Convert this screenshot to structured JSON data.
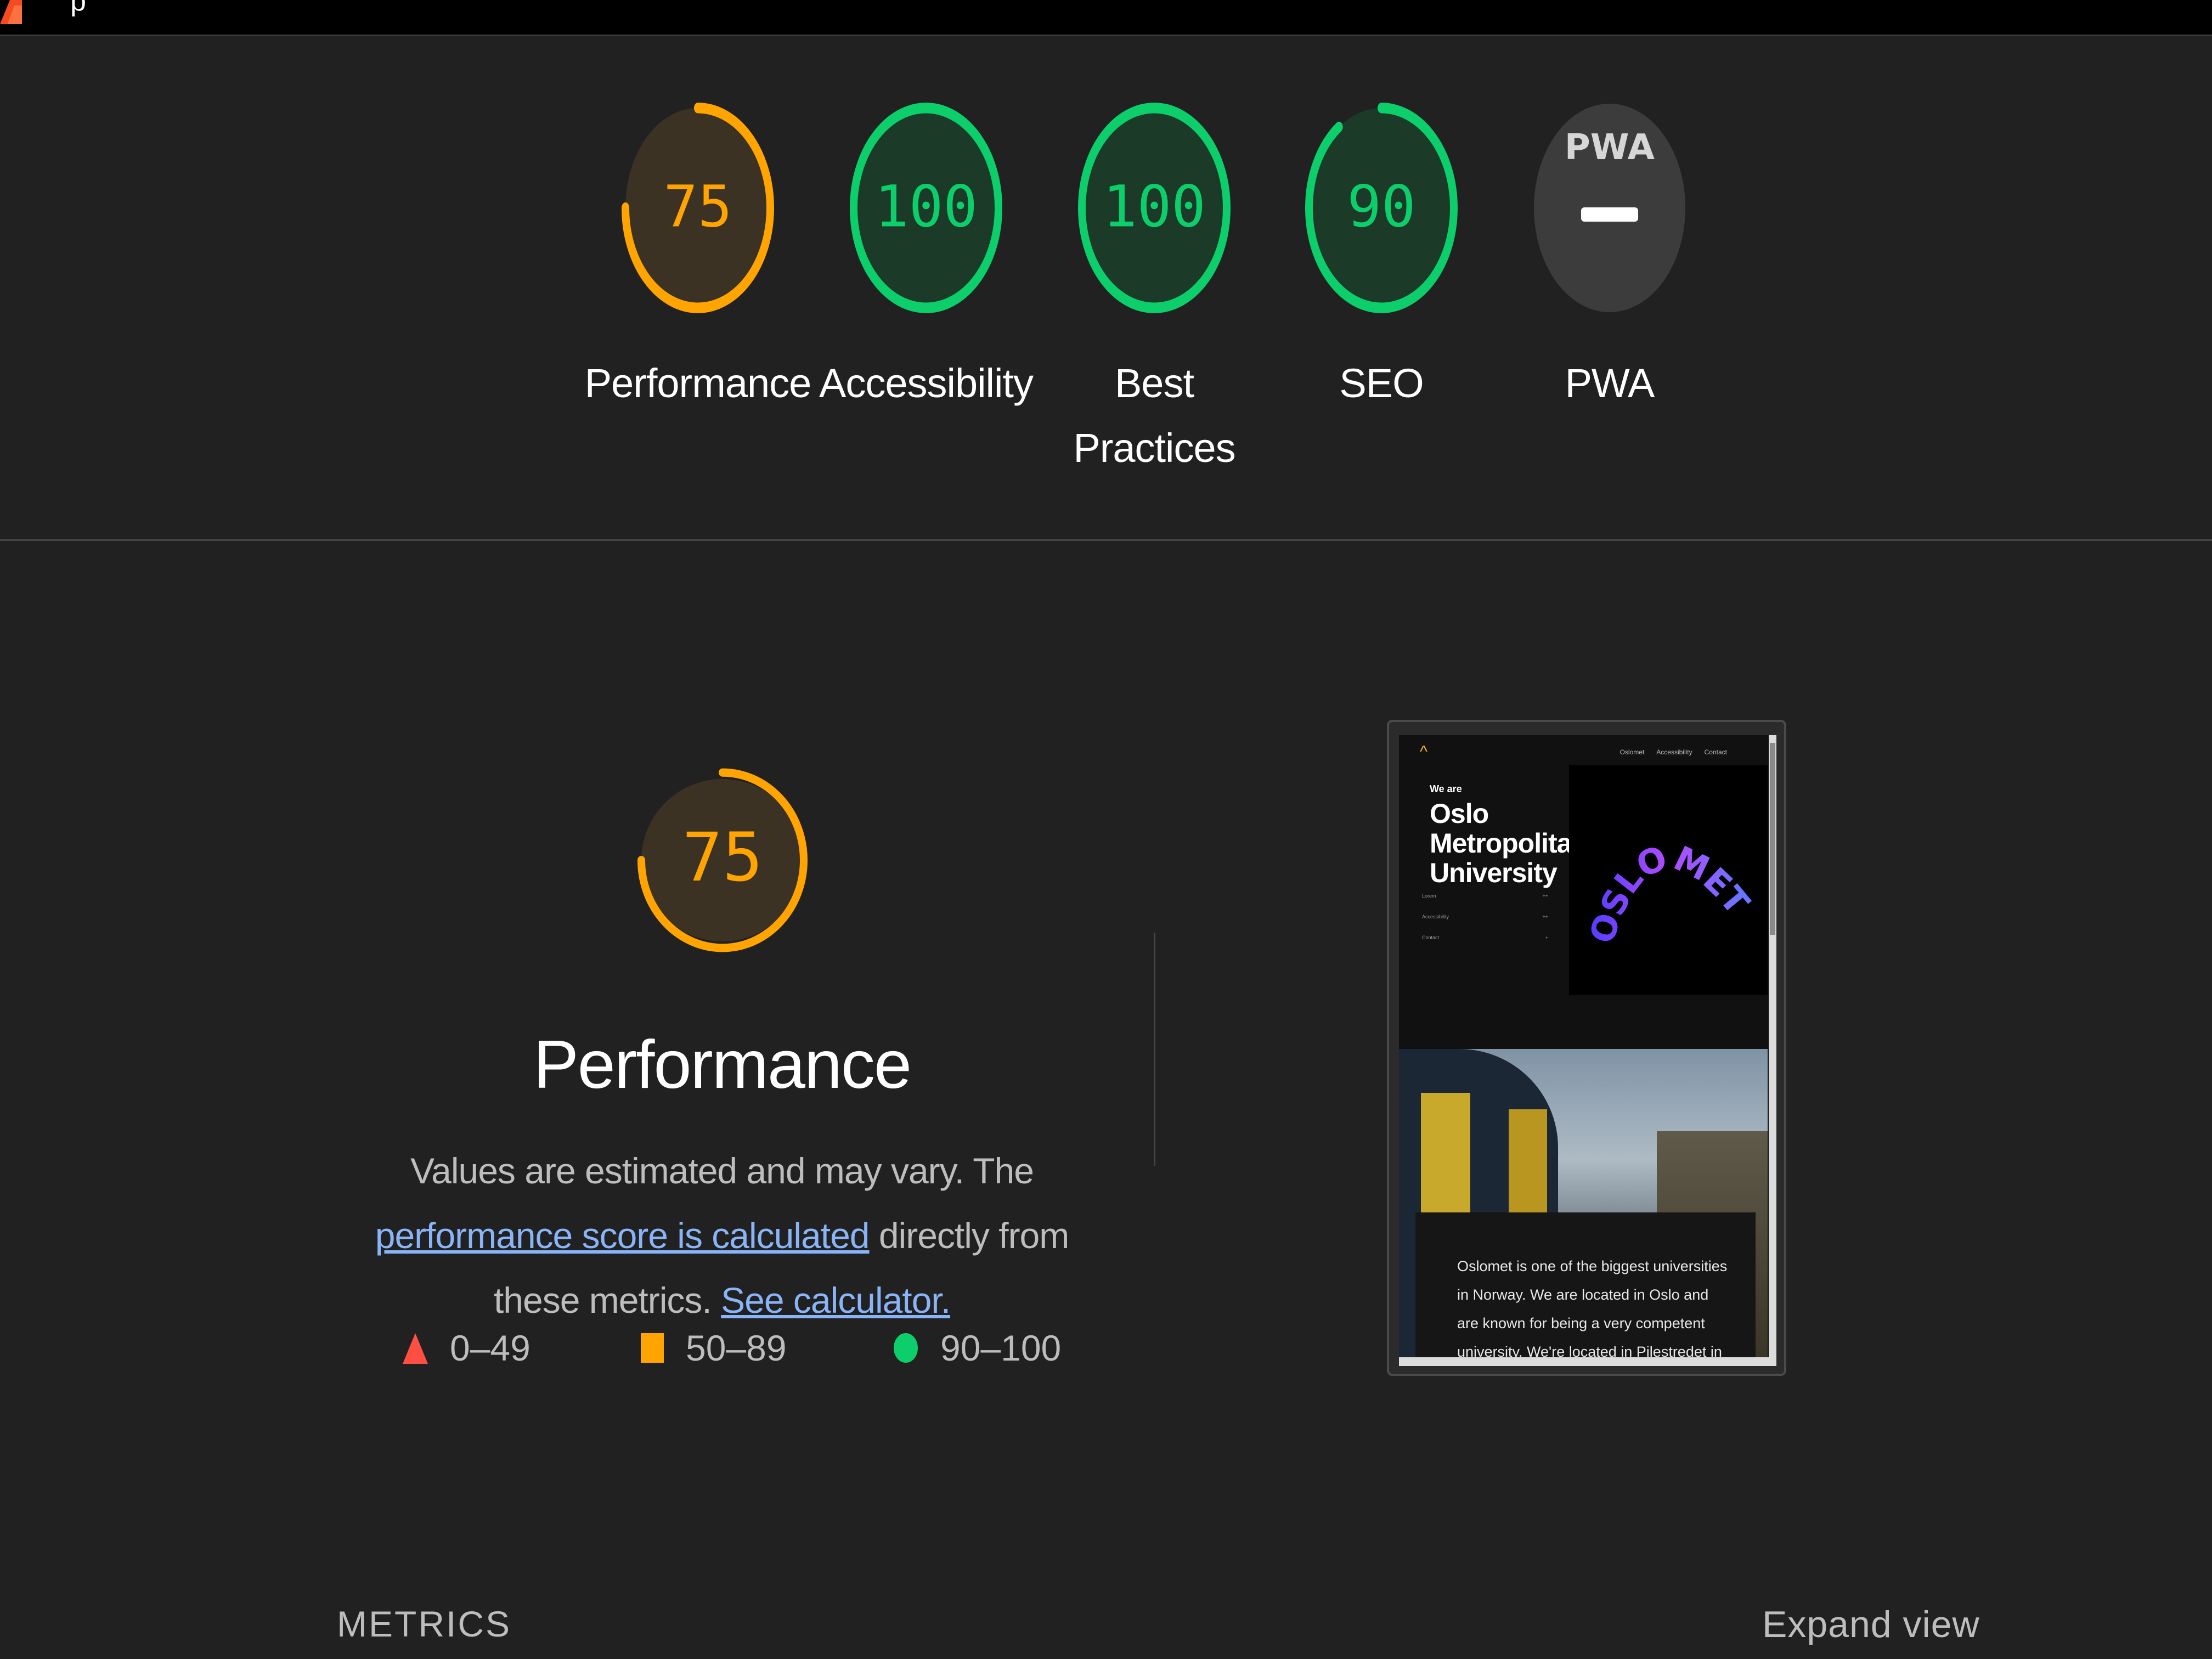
{
  "app": {
    "title_partial": "p"
  },
  "colors": {
    "background": "#212121",
    "pass": "#0cce6b",
    "average": "#ffa400",
    "fail": "#ff4e42",
    "link": "#8ab4f8",
    "pwa_gray": "#3c3c3c"
  },
  "categories": [
    {
      "label": "Performance",
      "score": 75,
      "status": "average",
      "icon": "score-gauge"
    },
    {
      "label": "Accessibility",
      "score": 100,
      "status": "pass",
      "icon": "score-gauge"
    },
    {
      "label": "Best Practices",
      "score": 100,
      "status": "pass",
      "icon": "score-gauge"
    },
    {
      "label": "SEO",
      "score": 90,
      "status": "pass",
      "icon": "score-gauge"
    },
    {
      "label": "PWA",
      "score": null,
      "status": "na",
      "badge_text": "PWA",
      "icon": "pwa-badge-icon"
    }
  ],
  "performance": {
    "score": 75,
    "title": "Performance",
    "description_prefix": "Values are estimated and may vary. The ",
    "link_score": "performance score is calculated",
    "description_middle": " directly from these metrics. ",
    "link_calculator": "See calculator.",
    "legend": [
      {
        "range": "0–49",
        "icon": "fail-triangle-icon",
        "status": "fail"
      },
      {
        "range": "50–89",
        "icon": "average-square-icon",
        "status": "average"
      },
      {
        "range": "90–100",
        "icon": "pass-circle-icon",
        "status": "pass"
      }
    ]
  },
  "screenshot": {
    "nav_items": [
      "Oslomet",
      "Accessibility",
      "Contact"
    ],
    "eyebrow": "We are",
    "heading": "Oslo Metropolitan University",
    "meta_rows": [
      {
        "label": "Lorem",
        "value": "++"
      },
      {
        "label": "Accessibility",
        "value": "++"
      },
      {
        "label": "Contact",
        "value": "+"
      }
    ],
    "logo_text": "OSLOMET",
    "caption": "Oslomet is one of the biggest universities in Norway. We are located in Oslo and are known for being a very competent university. We're located in Pilestredet in Oslo..."
  },
  "metrics": {
    "heading": "METRICS",
    "expand_label": "Expand view"
  }
}
